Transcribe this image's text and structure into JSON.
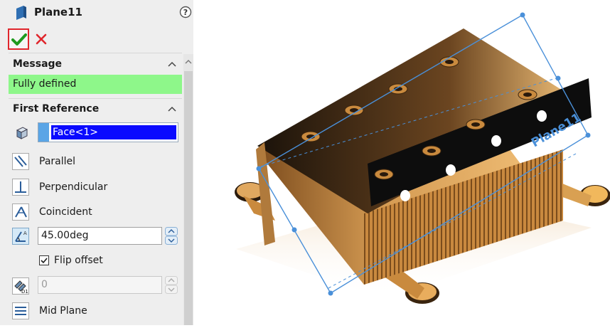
{
  "header": {
    "title": "Plane11"
  },
  "actions": {
    "ok": "confirm",
    "cancel": "cancel"
  },
  "message_section": {
    "heading": "Message",
    "text": "Fully defined"
  },
  "first_reference": {
    "heading": "First Reference",
    "selection": "Face<1>",
    "options": [
      "Parallel",
      "Perpendicular",
      "Coincident"
    ],
    "angle": "45.00deg",
    "flip_offset_label": "Flip offset",
    "flip_offset_checked": true,
    "offset_count": "0",
    "mid_plane_label": "Mid Plane"
  },
  "viewport": {
    "plane_label": "Plane11"
  },
  "colors": {
    "accent": "#0a0aff",
    "message_bg": "#8ef78a",
    "ok_border": "#e0262c",
    "plane_line": "#4a90d9"
  }
}
